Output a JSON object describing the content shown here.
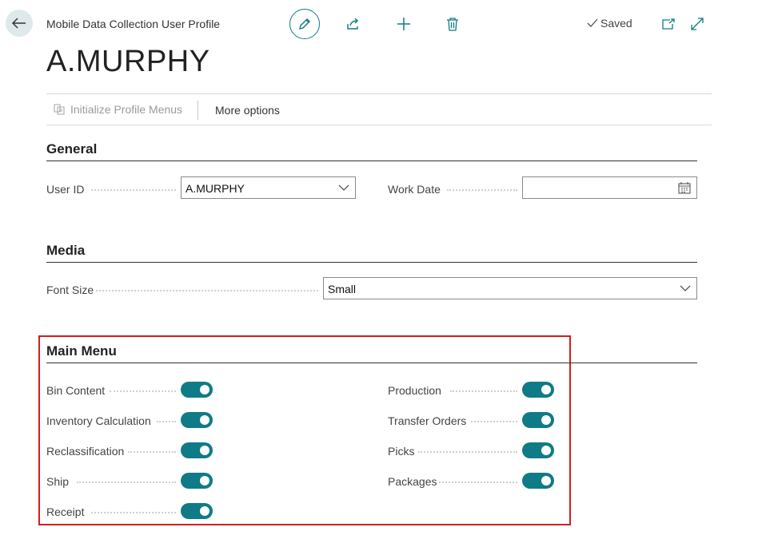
{
  "header": {
    "back_icon": "arrow-left-icon",
    "caption": "Mobile Data Collection User Profile",
    "title": "A.MURPHY",
    "saved_label": "Saved"
  },
  "actions": {
    "initialize": "Initialize Profile Menus",
    "more": "More options"
  },
  "general": {
    "title": "General",
    "user_id_label": "User ID",
    "user_id_value": "A.MURPHY",
    "work_date_label": "Work Date",
    "work_date_value": ""
  },
  "media": {
    "title": "Media",
    "font_size_label": "Font Size",
    "font_size_value": "Small"
  },
  "main_menu": {
    "title": "Main Menu",
    "items": [
      {
        "label": "Bin Content",
        "enabled": true
      },
      {
        "label": "Inventory Calculation",
        "enabled": true
      },
      {
        "label": "Reclassification",
        "enabled": true
      },
      {
        "label": "Ship",
        "enabled": true
      },
      {
        "label": "Receipt",
        "enabled": true
      },
      {
        "label": "Production",
        "enabled": true
      },
      {
        "label": "Transfer Orders",
        "enabled": true
      },
      {
        "label": "Picks",
        "enabled": true
      },
      {
        "label": "Packages",
        "enabled": true
      }
    ]
  },
  "colors": {
    "accent": "#0f7b86",
    "highlight_border": "#d41d1d"
  }
}
